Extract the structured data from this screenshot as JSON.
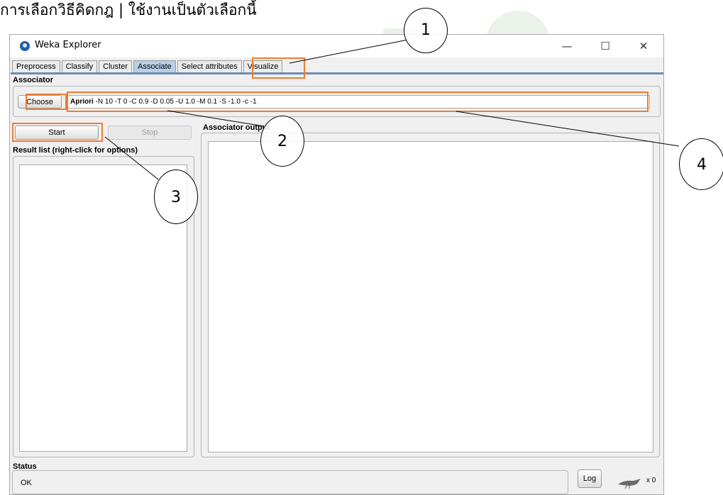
{
  "document": {
    "heading": "การเลือกวิธีคิดกฎ   | ใช้งานเป็นตัวเลือกนี้"
  },
  "window": {
    "title": "Weka Explorer",
    "controls": {
      "minimize": "—",
      "maximize": "☐",
      "close": "✕"
    }
  },
  "tabs": [
    {
      "label": "Preprocess",
      "active": false
    },
    {
      "label": "Classify",
      "active": false
    },
    {
      "label": "Cluster",
      "active": false
    },
    {
      "label": "Associate",
      "active": true
    },
    {
      "label": "Select attributes",
      "active": false
    },
    {
      "label": "Visualize",
      "active": false
    }
  ],
  "associator": {
    "section_label": "Associator",
    "choose_label": "Choose",
    "algorithm": "Apriori",
    "options": " -N 10 -T 0 -C 0.9 -D 0.05 -U 1.0 -M 0.1 -S -1.0 -c -1"
  },
  "controls": {
    "start_label": "Start",
    "stop_label": "Stop"
  },
  "result_list": {
    "label": "Result list (right-click for options)"
  },
  "output": {
    "label": "Associator output"
  },
  "status": {
    "section_label": "Status",
    "text": "OK",
    "log_label": "Log",
    "task_count": "x 0"
  },
  "annotations": [
    "1",
    "2",
    "3",
    "4"
  ],
  "colors": {
    "highlight": "#ed7d31",
    "active_tab": "#b8cfe5",
    "tab_line": "#6c8db5"
  }
}
